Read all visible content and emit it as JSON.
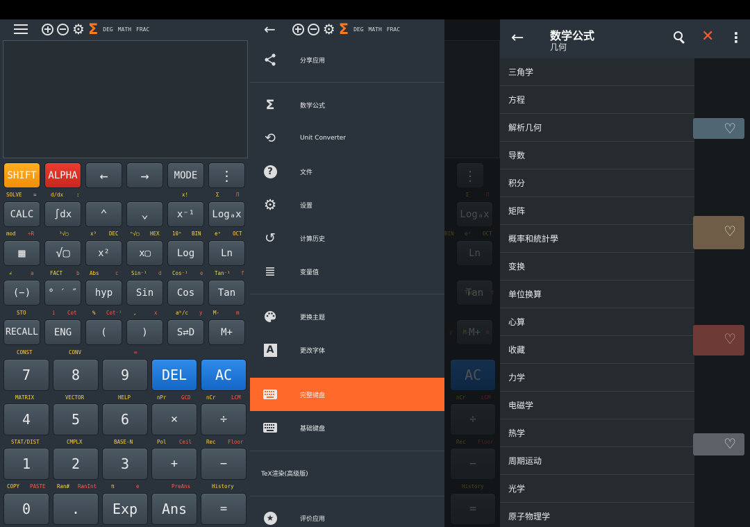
{
  "calc_toolbar": {
    "mode1": "DEG",
    "mode2": "MATH",
    "mode3": "FRAC"
  },
  "calc_rows": [
    {
      "keys": [
        "SHIFT",
        "ALPHA",
        "←",
        "→",
        "MODE",
        "⋮"
      ]
    },
    {
      "keys": [
        "CALC",
        "∫dx",
        "⌃",
        "⌄",
        "x⁻¹",
        "Logₐx"
      ]
    },
    {
      "keys": [
        "▦",
        "√▢",
        "x²",
        "x▢",
        "Log",
        "Ln"
      ]
    },
    {
      "keys": [
        "(−)",
        "° ′ ″",
        "hyp",
        "Sin",
        "Cos",
        "Tan"
      ]
    },
    {
      "keys": [
        "RECALL",
        "ENG",
        "(",
        ")",
        "S⇄D",
        "M+"
      ]
    }
  ],
  "num_rows": [
    {
      "keys": [
        "7",
        "8",
        "9",
        "DEL",
        "AC"
      ]
    },
    {
      "keys": [
        "4",
        "5",
        "6",
        "×",
        "÷"
      ]
    },
    {
      "keys": [
        "1",
        "2",
        "3",
        "+",
        "−"
      ]
    },
    {
      "keys": [
        "0",
        ".",
        "Exp",
        "Ans",
        "="
      ]
    }
  ],
  "sub_labels": {
    "r1": [
      "SOLVE",
      "=",
      "d/dx",
      ":",
      "x!",
      "Σ",
      "Π"
    ],
    "r2": [
      "mod",
      "÷R",
      "³√▢",
      "x³",
      "DEC",
      "ⁿ√▢",
      "HEX",
      "10ˣ",
      "BIN",
      "eˣ",
      "OCT"
    ],
    "r3": [
      "∠",
      "a",
      "FACT",
      "b",
      "Abs",
      "c",
      "Sin⁻¹",
      "d",
      "Cos⁻¹",
      "e",
      "Tan⁻¹",
      "f"
    ],
    "r4": [
      "STO",
      "i",
      "Cot",
      "%",
      "Cot⁻¹",
      ",",
      "x",
      "aᵇ/c",
      "y",
      "M-",
      "m"
    ],
    "r5": [
      "CONST",
      "CONV",
      "∞"
    ],
    "r6": [
      "MATRIX",
      "VECTOR",
      "HELP",
      "nPr",
      "GCD",
      "nCr",
      "LCM"
    ],
    "r7": [
      "STAT/DIST",
      "CMPLX",
      "BASE-N",
      "Pol",
      "Ceil",
      "Rec",
      "Floor"
    ],
    "r8": [
      "COPY",
      "PASTE",
      "Ran#",
      "RanInt",
      "π",
      "e",
      "PreAns",
      "History"
    ]
  },
  "drawer": {
    "items": [
      {
        "label": "分享应用",
        "icon": "share-icon"
      },
      {
        "label": "数学公式",
        "icon": "sigma-icon"
      },
      {
        "label": "Unit Converter",
        "icon": "sync-icon"
      },
      {
        "label": "文件",
        "icon": "help-icon"
      },
      {
        "label": "设置",
        "icon": "gear-icon"
      },
      {
        "label": "计算历史",
        "icon": "history-icon"
      },
      {
        "label": "变量值",
        "icon": "list-icon"
      },
      {
        "label": "更换主题",
        "icon": "palette-icon"
      },
      {
        "label": "更改字体",
        "icon": "font-icon"
      },
      {
        "label": "完整键盘",
        "icon": "keyboard-icon"
      },
      {
        "label": "基础键盘",
        "icon": "keyboard-icon"
      },
      {
        "label": "TeX渲染(高级版)"
      },
      {
        "label": "评价应用",
        "icon": "star-icon"
      }
    ],
    "active": "完整键盘"
  },
  "bg_calc": {
    "keys": [
      "⋮",
      "Logₐx",
      "Ln",
      "Tan",
      "M+",
      "AC",
      "÷",
      "−",
      "="
    ],
    "labels": [
      "Σ",
      "Π",
      "BIN",
      "eˣ",
      "OCT",
      "Tan⁻¹",
      "f",
      "y",
      "M-",
      "m",
      "nCr",
      "LCM",
      "Rec",
      "Floor",
      "History"
    ]
  },
  "formulas": {
    "title": "数学公式",
    "subtitle": "几何",
    "items": [
      "三角学",
      "方程",
      "解析几何",
      "导数",
      "积分",
      "矩阵",
      "概率和統計學",
      "变换",
      "单位换算",
      "心算",
      "收藏",
      "力学",
      "电磁学",
      "热学",
      "周期运动",
      "光学",
      "原子物理学"
    ]
  },
  "colors": {
    "accent": "#ff6a2b",
    "shift": "#f59a10",
    "alpha": "#d52f23",
    "blue": "#1f77d8"
  }
}
